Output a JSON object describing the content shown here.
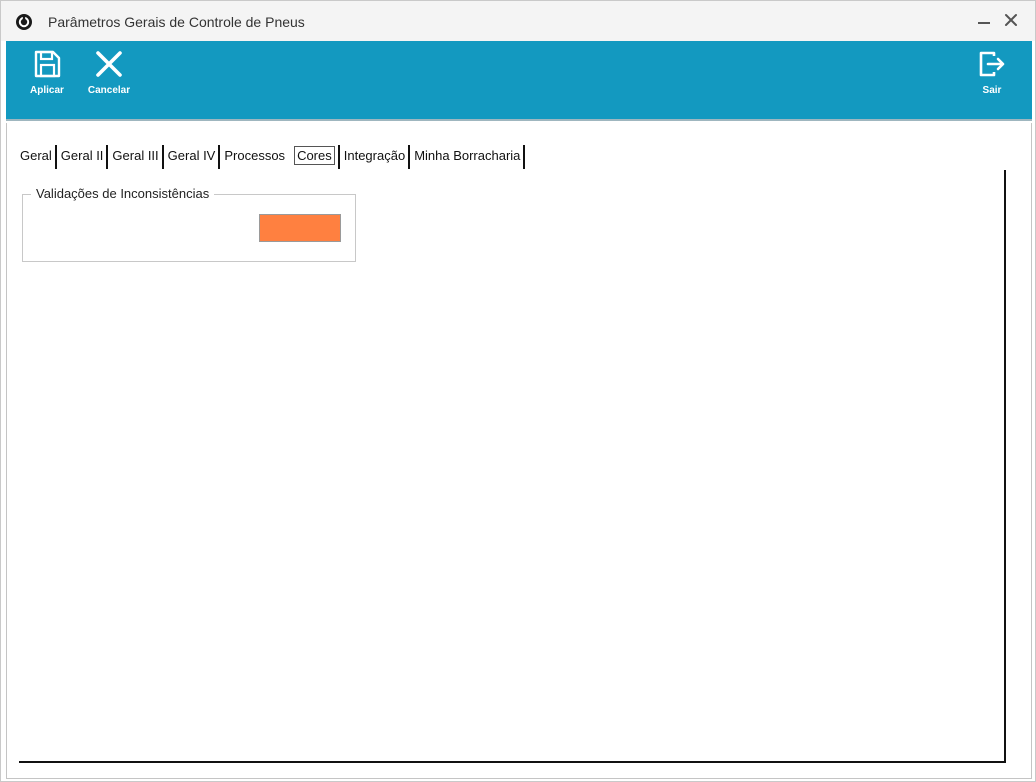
{
  "window": {
    "title": "Parâmetros Gerais de Controle de Pneus",
    "minimize_glyph": "—",
    "close_glyph": "✕"
  },
  "toolbar": {
    "apply_label": "Aplicar",
    "cancel_label": "Cancelar",
    "exit_label": "Sair",
    "background_color": "#1399c0"
  },
  "tabs": [
    {
      "label": "Geral"
    },
    {
      "label": "Geral II"
    },
    {
      "label": "Geral III"
    },
    {
      "label": "Geral IV"
    },
    {
      "label": "Processos"
    },
    {
      "label": "Cores",
      "active": true
    },
    {
      "label": "Integração"
    },
    {
      "label": "Minha Borracharia"
    }
  ],
  "group": {
    "legend": "Validações de Inconsistências",
    "swatch_color": "#ff8040"
  },
  "icons": {
    "app": "app-logo-icon",
    "apply": "floppy-disk-icon",
    "cancel": "close-x-icon",
    "exit": "exit-door-icon"
  }
}
